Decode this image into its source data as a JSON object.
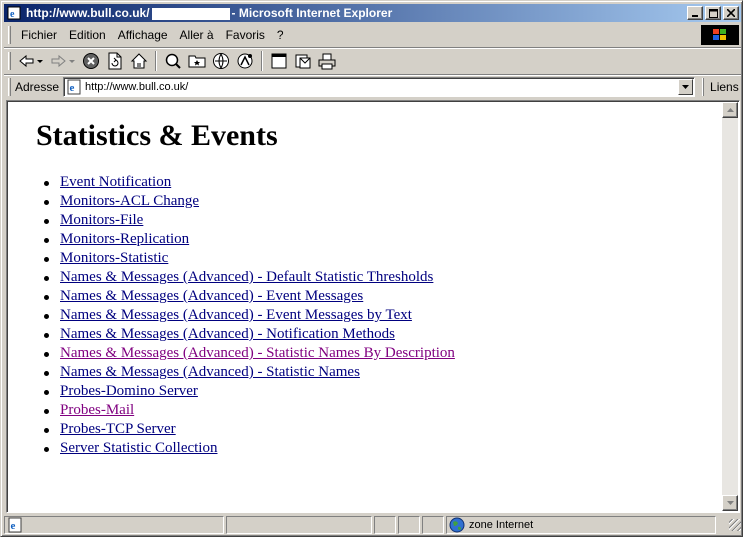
{
  "window": {
    "title_prefix": "http://www.bull.co.uk/",
    "title_suffix": "- Microsoft Internet Explorer"
  },
  "menu": {
    "items": [
      {
        "label": "Fichier"
      },
      {
        "label": "Edition"
      },
      {
        "label": "Affichage"
      },
      {
        "label": "Aller à"
      },
      {
        "label": "Favoris"
      },
      {
        "label": "?"
      }
    ]
  },
  "toolbar": {
    "buttons": [
      "back-icon",
      "forward-icon",
      "stop-icon",
      "refresh-icon",
      "home-icon",
      "search-icon",
      "favorites-icon",
      "history-icon",
      "channels-icon",
      "fullscreen-icon",
      "mail-icon",
      "print-icon"
    ]
  },
  "address": {
    "label": "Adresse",
    "value": "http://www.bull.co.uk/",
    "links_label": "Liens"
  },
  "page": {
    "title": "Statistics & Events",
    "links": [
      {
        "text": "Event Notification",
        "visited": false
      },
      {
        "text": "Monitors-ACL Change",
        "visited": false
      },
      {
        "text": "Monitors-File",
        "visited": false
      },
      {
        "text": "Monitors-Replication",
        "visited": false
      },
      {
        "text": "Monitors-Statistic",
        "visited": false
      },
      {
        "text": "Names & Messages (Advanced) - Default Statistic Thresholds",
        "visited": false
      },
      {
        "text": "Names & Messages (Advanced) - Event Messages",
        "visited": false
      },
      {
        "text": "Names & Messages (Advanced) - Event Messages by Text",
        "visited": false
      },
      {
        "text": "Names & Messages (Advanced) - Notification Methods",
        "visited": false
      },
      {
        "text": "Names & Messages (Advanced) - Statistic Names By Description",
        "visited": true
      },
      {
        "text": "Names & Messages (Advanced) - Statistic Names",
        "visited": false
      },
      {
        "text": "Probes-Domino Server",
        "visited": false
      },
      {
        "text": "Probes-Mail",
        "visited": true
      },
      {
        "text": "Probes-TCP Server",
        "visited": false
      },
      {
        "text": "Server Statistic Collection",
        "visited": false
      }
    ]
  },
  "status": {
    "zone_label": "zone Internet"
  },
  "colors": {
    "link": "#00007f",
    "visited_link": "#800080",
    "titlebar_start": "#0a246a",
    "titlebar_end": "#a6caf0"
  }
}
